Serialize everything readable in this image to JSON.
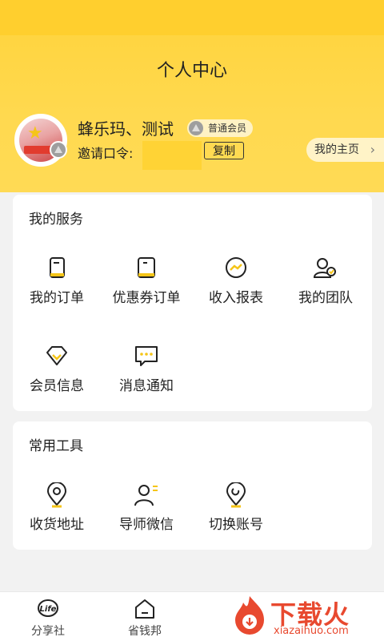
{
  "header": {
    "title": "个人中心",
    "username": "蜂乐玛、测试",
    "member_level": "普通会员",
    "invite_label": "邀请口令:",
    "copy_label": "复制",
    "homepage_label": "我的主页",
    "accent_color": "#ffd33a"
  },
  "services": {
    "title": "我的服务",
    "items": [
      {
        "label": "我的订单",
        "icon": "order-icon"
      },
      {
        "label": "优惠券订单",
        "icon": "coupon-order-icon"
      },
      {
        "label": "收入报表",
        "icon": "income-report-icon"
      },
      {
        "label": "我的团队",
        "icon": "team-icon"
      },
      {
        "label": "会员信息",
        "icon": "diamond-icon"
      },
      {
        "label": "消息通知",
        "icon": "message-icon"
      }
    ]
  },
  "tools": {
    "title": "常用工具",
    "items": [
      {
        "label": "收货地址",
        "icon": "location-icon"
      },
      {
        "label": "导师微信",
        "icon": "mentor-icon"
      },
      {
        "label": "切换账号",
        "icon": "switch-account-icon"
      }
    ]
  },
  "tabbar": {
    "items": [
      {
        "label": "分享社",
        "icon": "life-icon"
      },
      {
        "label": "省钱邦",
        "icon": "home-icon"
      }
    ]
  },
  "watermark": {
    "text": "下载火",
    "url": "xiazaihuo.com"
  }
}
